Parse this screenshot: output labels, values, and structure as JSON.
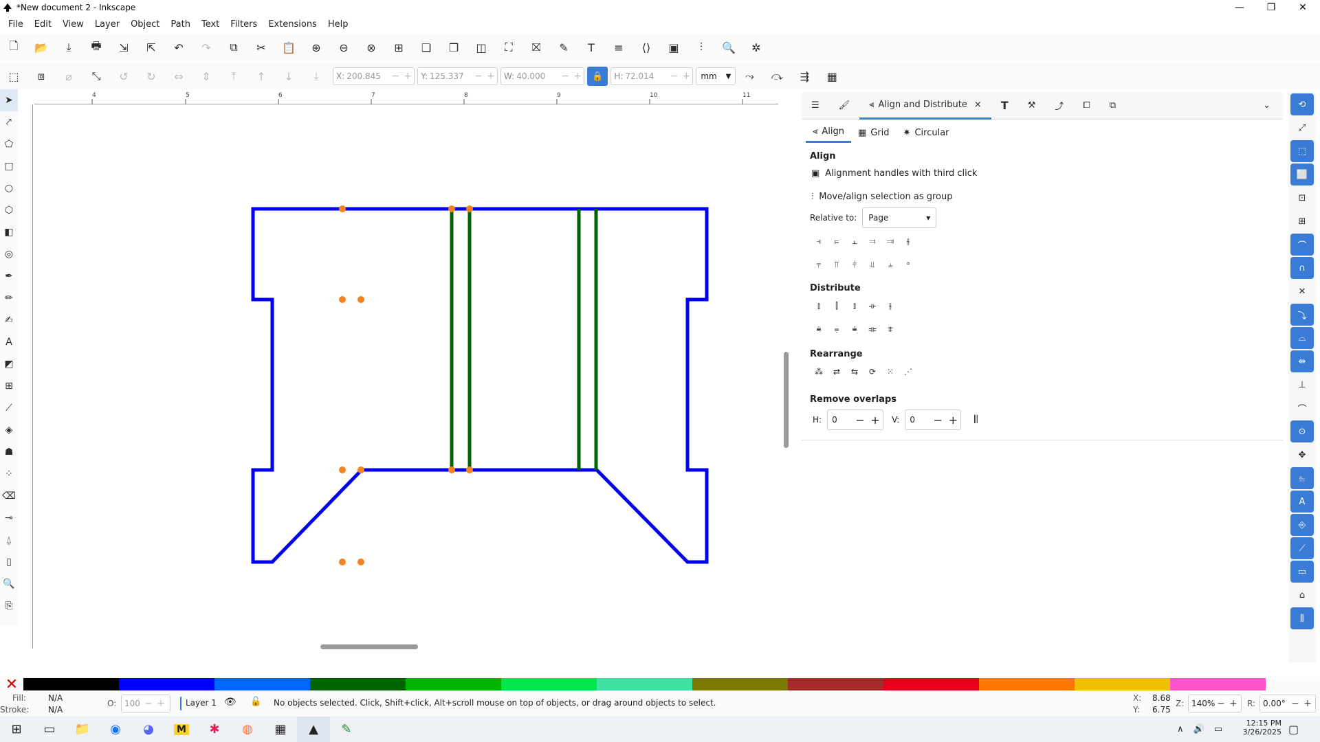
{
  "window": {
    "title": "*New document 2 - Inkscape"
  },
  "menu": [
    "File",
    "Edit",
    "View",
    "Layer",
    "Object",
    "Path",
    "Text",
    "Filters",
    "Extensions",
    "Help"
  ],
  "toolcontrols": {
    "x_label": "X:",
    "x_value": "200.845",
    "y_label": "Y:",
    "y_value": "125.337",
    "w_label": "W:",
    "w_value": "40.000",
    "h_label": "H:",
    "h_value": "72.014",
    "unit": "mm"
  },
  "ruler": {
    "labels": [
      "4",
      "5",
      "6",
      "7",
      "8",
      "9",
      "10",
      "11"
    ]
  },
  "panel": {
    "tab_title": "Align and Distribute",
    "subtabs": [
      "Align",
      "Grid",
      "Circular"
    ],
    "align_heading": "Align",
    "option_handles": "Alignment handles with third click",
    "option_group": "Move/align selection as group",
    "relative_label": "Relative to:",
    "relative_value": "Page",
    "distribute_heading": "Distribute",
    "rearrange_heading": "Rearrange",
    "overlaps_heading": "Remove overlaps",
    "h_label": "H:",
    "h_value": "0",
    "v_label": "V:",
    "v_value": "0"
  },
  "status": {
    "fill_label": "Fill:",
    "fill_value": "N/A",
    "stroke_label": "Stroke:",
    "stroke_value": "N/A",
    "opacity_label": "O:",
    "opacity_value": "100",
    "layer": "Layer 1",
    "message": "No objects selected. Click, Shift+click, Alt+scroll mouse on top of objects, or drag around objects to select.",
    "x_label": "X:",
    "x_value": "8.68",
    "y_label": "Y:",
    "y_value": "6.75",
    "zoom_label": "Z:",
    "zoom_value": "140%",
    "rot_label": "R:",
    "rot_value": "0.00°"
  },
  "taskbar": {
    "time": "12:15 PM",
    "date": "3/26/2025"
  },
  "colors": {
    "shape_outline": "#0000ee",
    "inner_lines": "#006400",
    "nodes": "#f58220",
    "accent": "#3a7bd5"
  },
  "palette": [
    "#000000",
    "#0000ff",
    "#0066ff",
    "#006400",
    "#00b300",
    "#00e64d",
    "#40e0a0",
    "#7a7a00",
    "#a52a2a",
    "#e6001a",
    "#ff7700",
    "#f0c000",
    "#ff55cc"
  ]
}
